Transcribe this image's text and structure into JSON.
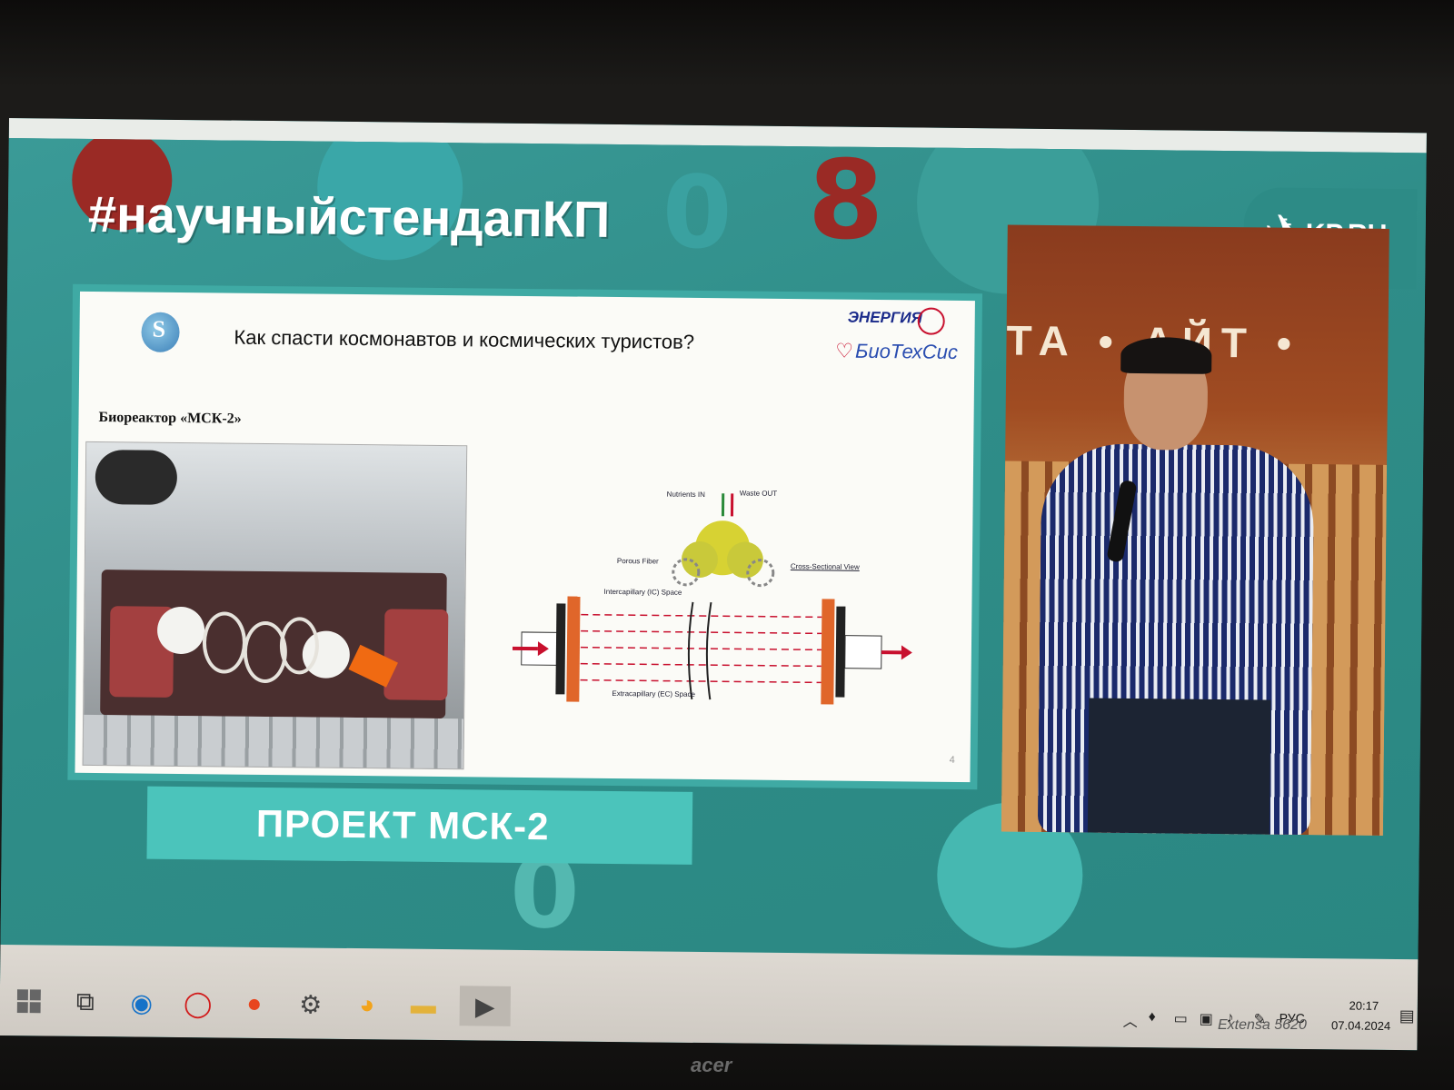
{
  "broadcast": {
    "hashtag": "#научныйстендапКП",
    "channel_logo_text": "KP.RU",
    "project_title": "ПРОЕКТ МСК-2",
    "backdrop_sign": "ТА • АЙТ •"
  },
  "slide": {
    "title": "Как спасти космонавтов и космических туристов?",
    "subtitle": "Биореактор «МСК-2»",
    "partner_1": "ЭНЕРГИЯ",
    "partner_2": "БиоТехСис",
    "page_number": "4",
    "diagram_labels": {
      "nutrients": "Nutrients IN",
      "waste": "Waste OUT",
      "porous": "Porous Fiber",
      "cross": "Cross-Sectional View",
      "intercapillary": "Intercapillary (IC) Space",
      "extracapillary": "Extracapillary (EC) Space"
    }
  },
  "taskbar": {
    "language": "РУС",
    "time": "20:17",
    "date": "07.04.2024"
  },
  "hardware": {
    "model": "Extensa 5620",
    "brand": "acer"
  },
  "colors": {
    "teal_bg": "#2f8f8a",
    "banner": "#4bc4bb",
    "arrow_red": "#c8102e",
    "fiber_orange": "#e0662a"
  }
}
